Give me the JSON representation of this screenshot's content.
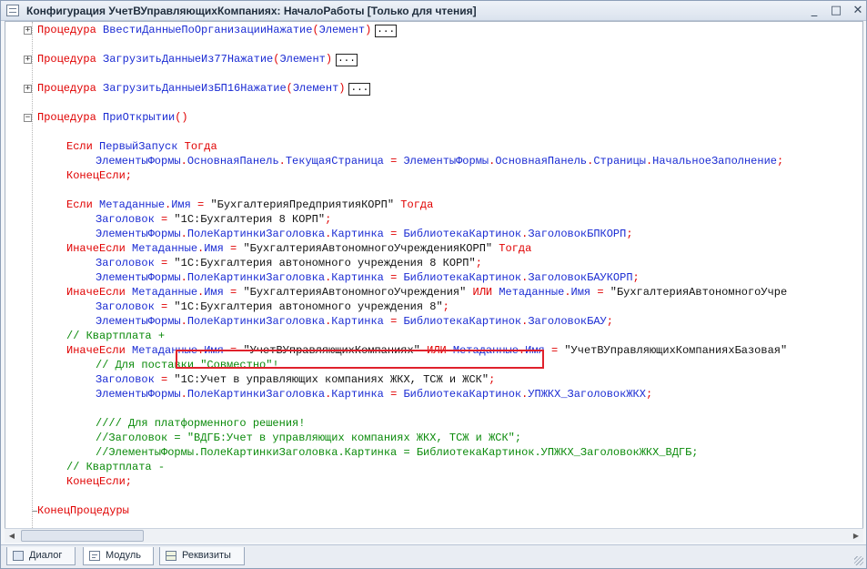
{
  "window": {
    "title": "Конфигурация УчетВУправляющихКомпаниях: НачалоРаботы [Только для чтения]",
    "buttons": {
      "minimize": "_",
      "maximize": "□",
      "close": "✕"
    }
  },
  "editor": {
    "collapsed_marker": "...",
    "lines": [
      "Процедура ВвестиДанныеПоОрганизацииНажатие(Элемент)",
      "Процедура ЗагрузитьДанныеИз77Нажатие(Элемент)",
      "Процедура ЗагрузитьДанныеИзБП16Нажатие(Элемент)",
      "Процедура ПриОткрытии()",
      "Если ПервыйЗапуск Тогда",
      "ЭлементыФормы.ОсновнаяПанель.ТекущаяСтраница = ЭлементыФормы.ОсновнаяПанель.Страницы.НачальноеЗаполнение;",
      "КонецЕсли;",
      "Если Метаданные.Имя = \"БухгалтерияПредприятияКОРП\" Тогда",
      "Заголовок = \"1С:Бухгалтерия 8 КОРП\";",
      "ЭлементыФормы.ПолеКартинкиЗаголовка.Картинка = БиблиотекаКартинок.ЗаголовокБПКОРП;",
      "ИначеЕсли Метаданные.Имя = \"БухгалтерияАвтономногоУчрежденияКОРП\" Тогда",
      "Заголовок = \"1С:Бухгалтерия автономного учреждения 8 КОРП\";",
      "ЭлементыФормы.ПолеКартинкиЗаголовка.Картинка = БиблиотекаКартинок.ЗаголовокБАУКОРП;",
      "ИначеЕсли Метаданные.Имя = \"БухгалтерияАвтономногоУчреждения\" ИЛИ Метаданные.Имя = \"БухгалтерияАвтономногоУчре",
      "Заголовок = \"1С:Бухгалтерия автономного учреждения 8\";",
      "ЭлементыФормы.ПолеКартинкиЗаголовка.Картинка = БиблиотекаКартинок.ЗаголовокБАУ;",
      "// Квартплата +",
      "ИначеЕсли Метаданные.Имя = \"УчетВУправляющихКомпаниях\" ИЛИ Метаданные.Имя = \"УчетВУправляющихКомпанияхБазовая\"",
      "// Для поставки \"Совместно\"!",
      "Заголовок = \"1С:Учет в управляющих компаниях ЖКХ, ТСЖ и ЖСК\";",
      "ЭлементыФормы.ПолеКартинкиЗаголовка.Картинка = БиблиотекаКартинок.УПЖКХ_ЗаголовокЖКХ;",
      "//// Для платформенного решения!",
      "//Заголовок = \"ВДГБ:Учет в управляющих компаниях ЖКХ, ТСЖ и ЖСК\";",
      "//ЭлементыФормы.ПолеКартинкиЗаголовка.Картинка = БиблиотекаКартинок.УПЖКХ_ЗаголовокЖКХ_ВДГБ;",
      "// Квартплата -",
      "КонецЕсли;",
      "КонецПроцедуры"
    ]
  },
  "tabs": [
    {
      "label": "Диалог",
      "icon": "dialog-icon",
      "active": false
    },
    {
      "label": "Модуль",
      "icon": "module-icon",
      "active": true
    },
    {
      "label": "Реквизиты",
      "icon": "props-icon",
      "active": false
    }
  ],
  "colors": {
    "keyword": "#e00000",
    "identifier": "#1a2bd3",
    "comment": "#0a8a0a",
    "string": "#111111",
    "highlight": "#e0212c"
  }
}
